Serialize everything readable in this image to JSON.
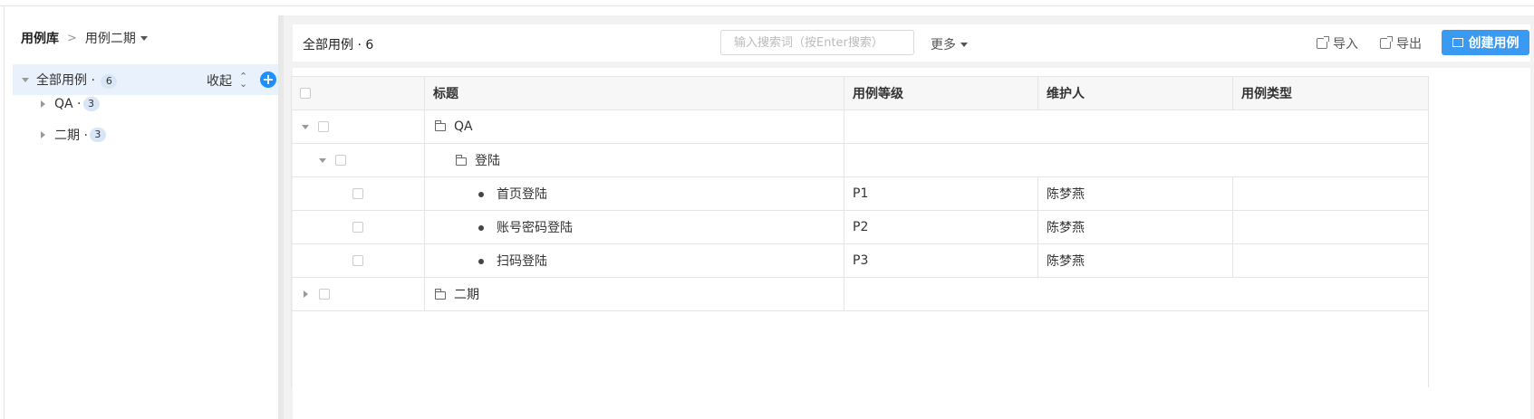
{
  "breadcrumb": {
    "library": "用例库",
    "project": "用例二期"
  },
  "tree": {
    "root": {
      "label": "全部用例 · ",
      "count": "6"
    },
    "collapse_label": "收起",
    "plus": "+",
    "children": [
      {
        "label": "QA · ",
        "count": "3"
      },
      {
        "label": "二期 · ",
        "count": "3"
      }
    ]
  },
  "toolbar": {
    "title": "全部用例 · 6",
    "search_placeholder": "输入搜索词（按Enter搜索）",
    "more": "更多",
    "import": "导入",
    "export": "导出",
    "create": "创建用例"
  },
  "table": {
    "columns": [
      "标题",
      "用例等级",
      "维护人",
      "用例类型"
    ],
    "rows": [
      {
        "type": "folder",
        "title": "QA"
      },
      {
        "type": "folder",
        "title": "登陆"
      },
      {
        "type": "case",
        "title": "首页登陆",
        "level": "P1",
        "owner": "陈梦燕",
        "case_type": ""
      },
      {
        "type": "case",
        "title": "账号密码登陆",
        "level": "P2",
        "owner": "陈梦燕",
        "case_type": ""
      },
      {
        "type": "case",
        "title": "扫码登陆",
        "level": "P3",
        "owner": "陈梦燕",
        "case_type": ""
      },
      {
        "type": "folder",
        "title": "二期"
      }
    ]
  },
  "colors": {
    "accent": "#3a99f0",
    "selected_bg": "#e9f2fc",
    "plus": "#1f8fff"
  }
}
